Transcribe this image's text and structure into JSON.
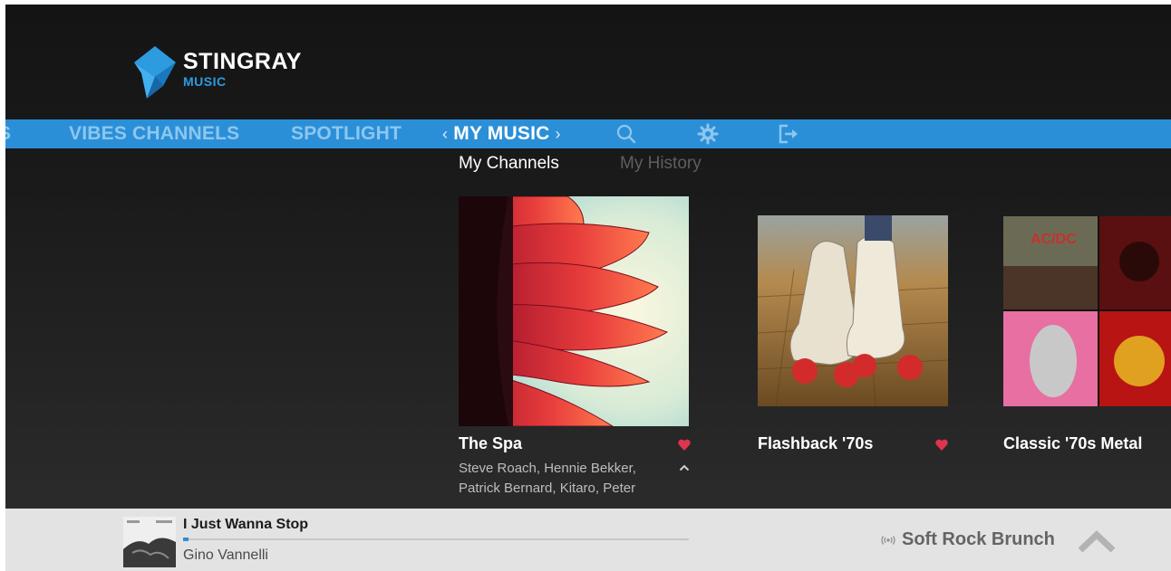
{
  "brand": {
    "name": "STINGRAY",
    "sub": "MUSIC"
  },
  "nav": {
    "cut_item": "S",
    "items": [
      {
        "label": "VIBES CHANNELS"
      },
      {
        "label": "SPOTLIGHT"
      }
    ],
    "active": {
      "label": "MY MUSIC",
      "prev": "‹",
      "next": "›"
    },
    "icons": [
      "search-icon",
      "settings-icon",
      "sign-out-icon"
    ]
  },
  "subtabs": {
    "active": "My Channels",
    "inactive": "My History"
  },
  "channels": [
    {
      "title": "The Spa",
      "favorite": true,
      "artists_line1": "Steve Roach, Hennie Bekker,",
      "artists_line2": "Patrick Bernard, Kitaro, Peter",
      "expanded": true
    },
    {
      "title": "Flashback '70s",
      "favorite": true
    },
    {
      "title": "Classic '70s Metal"
    }
  ],
  "player": {
    "track": "I Just Wanna Stop",
    "artist": "Gino Vannelli",
    "progress": 0.01,
    "station": "Soft Rock Brunch"
  },
  "colors": {
    "accent": "#2b8fd8",
    "nav_inactive": "#8cc7ee",
    "heart": "#e0344d",
    "background": "#1a1a1a",
    "player_bar": "#e3e3e3"
  }
}
